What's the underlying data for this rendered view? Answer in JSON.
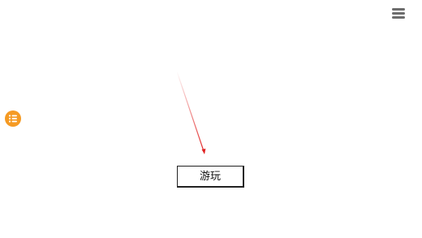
{
  "top_right": {
    "icon": "hamburger-menu-icon",
    "color": "#6d6d6d"
  },
  "left_float": {
    "icon": "list-icon",
    "color": "#f59a23"
  },
  "pointer": {
    "color": "#e02020"
  },
  "main": {
    "play_label": "游玩"
  }
}
